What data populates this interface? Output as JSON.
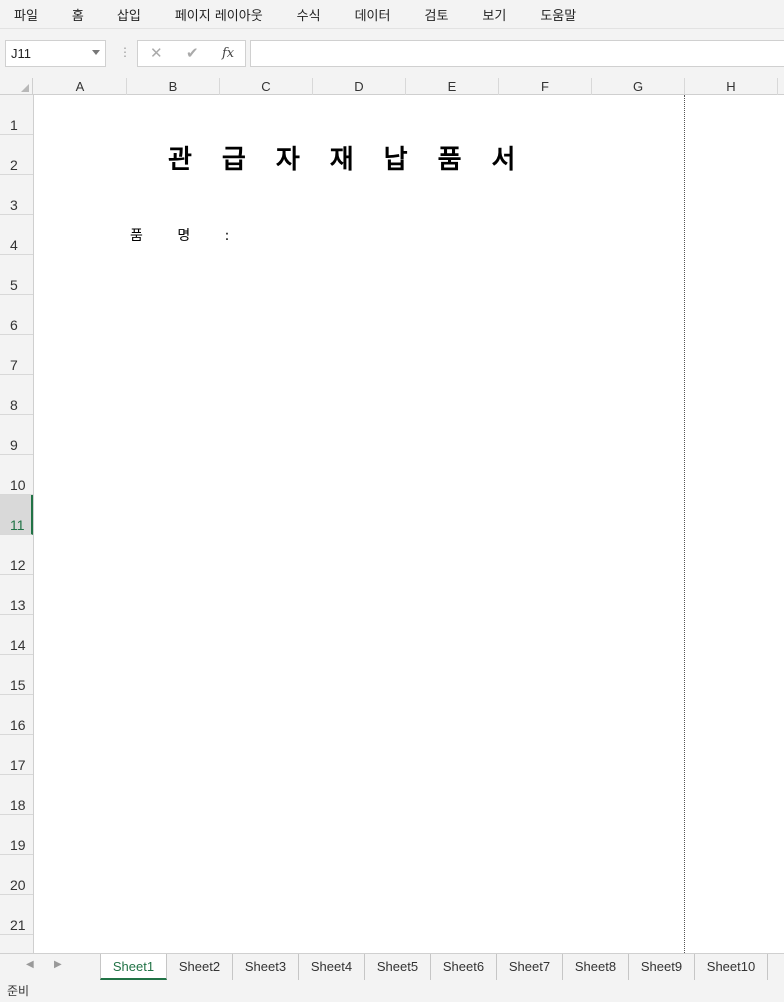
{
  "menu": [
    "파일",
    "홈",
    "삽입",
    "페이지 레이아웃",
    "수식",
    "데이터",
    "검토",
    "보기",
    "도움말"
  ],
  "formula_bar": {
    "name_box": "J11",
    "cancel_glyph": "✕",
    "enter_glyph": "✔",
    "fx_label": "fx",
    "separator": "⋮",
    "formula_value": ""
  },
  "columns": [
    "A",
    "B",
    "C",
    "D",
    "E",
    "F",
    "G",
    "H"
  ],
  "rows": [
    "1",
    "2",
    "3",
    "4",
    "5",
    "6",
    "7",
    "8",
    "9",
    "10",
    "11",
    "12",
    "13",
    "14",
    "15",
    "16",
    "17",
    "18",
    "19",
    "20",
    "21"
  ],
  "selected_row": "11",
  "sheet": {
    "title": "관급자재납품서",
    "item_label": "품 명 :"
  },
  "tabs": [
    "Sheet1",
    "Sheet2",
    "Sheet3",
    "Sheet4",
    "Sheet5",
    "Sheet6",
    "Sheet7",
    "Sheet8",
    "Sheet9",
    "Sheet10"
  ],
  "active_tab": "Sheet1",
  "status": "준비",
  "colors": {
    "accent": "#217346",
    "chrome": "#f3f3f3"
  }
}
